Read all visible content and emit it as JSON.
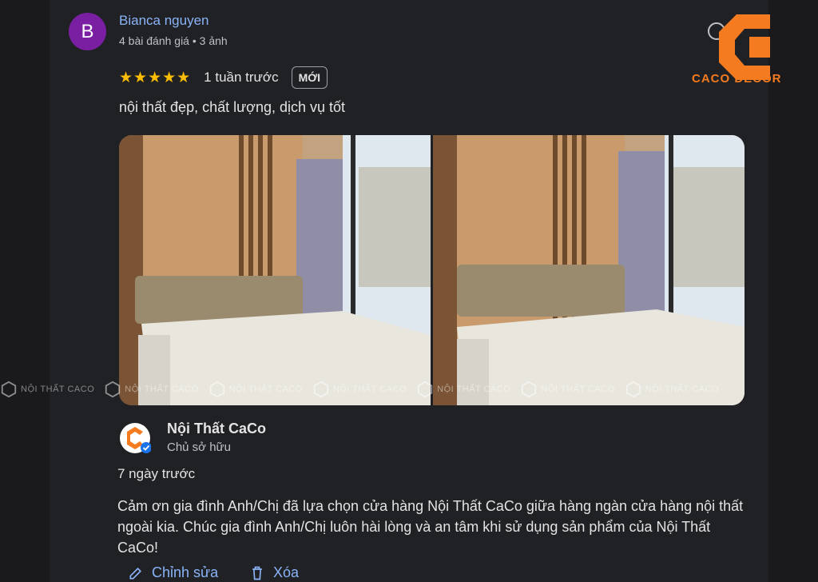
{
  "review": {
    "avatar_letter": "B",
    "reviewer_name": "Bianca nguyen",
    "reviewer_meta": "4 bài đánh giá • 3 ảnh",
    "stars": "★★★★★",
    "rating": 5,
    "time": "1 tuần trước",
    "badge": "MỚI",
    "text": "nội thất đẹp, chất lượng, dịch vụ tốt"
  },
  "watermark": "NỘI THẤT CACO",
  "owner_reply": {
    "name": "Nội Thất CaCo",
    "role": "Chủ sở hữu",
    "time": "7 ngày trước",
    "text": "Cảm ơn gia đình Anh/Chị đã lựa chọn cửa hàng Nội Thất CaCo giữa hàng ngàn cửa hàng nội thất ngoài kia. Chúc gia đình Anh/Chị luôn hài lòng và an tâm khi sử dụng sản phẩm của Nội Thất CaCo!"
  },
  "actions": {
    "edit": "Chỉnh sửa",
    "delete": "Xóa"
  },
  "brand": {
    "text": "CACO DECOR"
  },
  "colors": {
    "accent_blue": "#8ab4f8",
    "star": "#fbbc04",
    "avatar": "#7b1fa2",
    "brand_orange": "#f47b20"
  }
}
